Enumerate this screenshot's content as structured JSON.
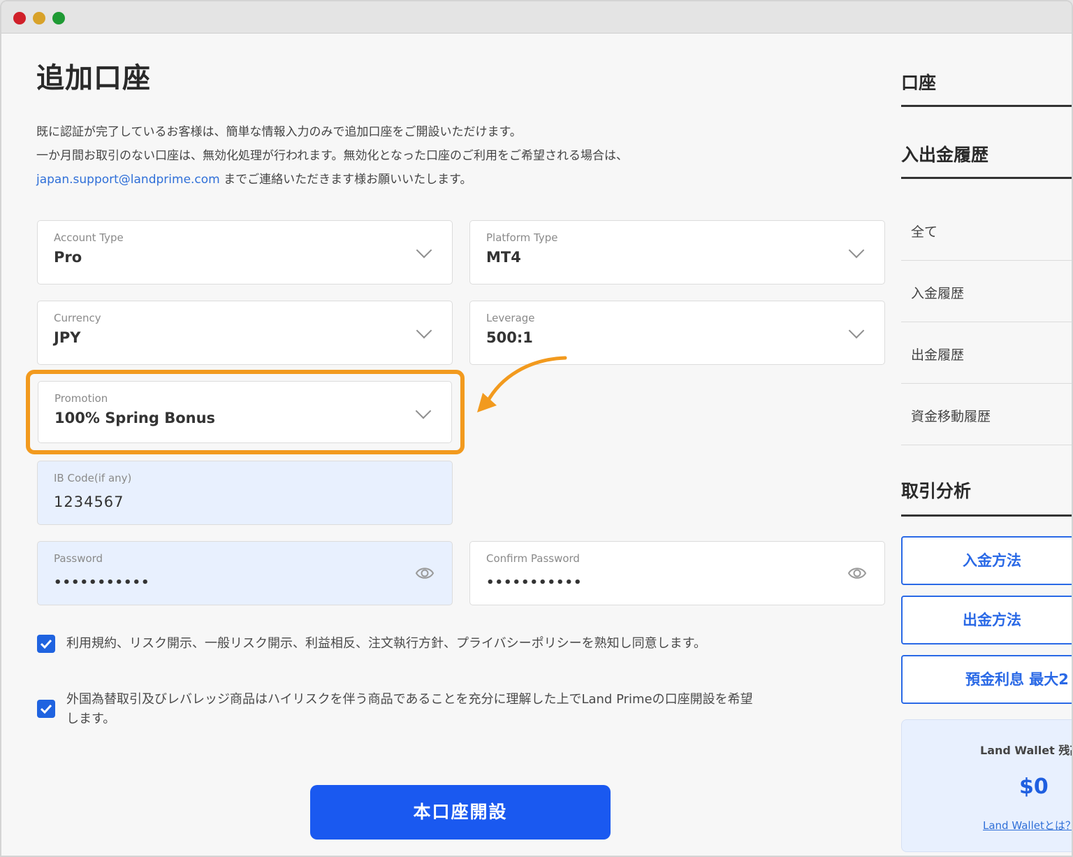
{
  "window": {
    "controls": [
      "close",
      "minimize",
      "maximize"
    ]
  },
  "page": {
    "title": "追加口座",
    "intro_line1": "既に認証が完了しているお客様は、簡単な情報入力のみで追加口座をご開設いただけます。",
    "intro_line2": "一か月間お取引のない口座は、無効化処理が行われます。無効化となった口座のご利用をご希望される場合は、",
    "intro_email": "japan.support@landprime.com",
    "intro_line3_rest": " までご連絡いただきます様お願いいたします。"
  },
  "form": {
    "account_type": {
      "label": "Account Type",
      "value": "Pro"
    },
    "platform_type": {
      "label": "Platform Type",
      "value": "MT4"
    },
    "currency": {
      "label": "Currency",
      "value": "JPY"
    },
    "leverage": {
      "label": "Leverage",
      "value": "500:1"
    },
    "promotion": {
      "label": "Promotion",
      "value": "100% Spring Bonus"
    },
    "ib_code": {
      "label": "IB Code(if any)",
      "value": "1234567"
    },
    "password": {
      "label": "Password",
      "value": "•••••••••••"
    },
    "confirm_password": {
      "label": "Confirm Password",
      "value": "•••••••••••"
    },
    "agree1": "利用規約、リスク開示、一般リスク開示、利益相反、注文執行方針、プライバシーポリシーを熟知し同意します。",
    "agree2_line1": "外国為替取引及びレバレッジ商品はハイリスクを伴う商品であることを充分に理解した上でLand Primeの口座開設を希望",
    "agree2_line2": "します。",
    "submit": "本口座開設"
  },
  "sidebar": {
    "account_heading": "口座",
    "history_heading": "入出金履歴",
    "history_items": [
      "全て",
      "入金履歴",
      "出金履歴",
      "資金移動履歴"
    ],
    "analysis_heading": "取引分析",
    "buttons": [
      "入金方法",
      "出金方法",
      "預金利息 最大2"
    ],
    "wallet": {
      "label": "Land Wallet 残高",
      "value": "$0",
      "link": "Land Walletとは？"
    }
  },
  "colors": {
    "accent": "#1a59f0",
    "highlight": "#f29a1e",
    "link": "#2f6fd8"
  }
}
